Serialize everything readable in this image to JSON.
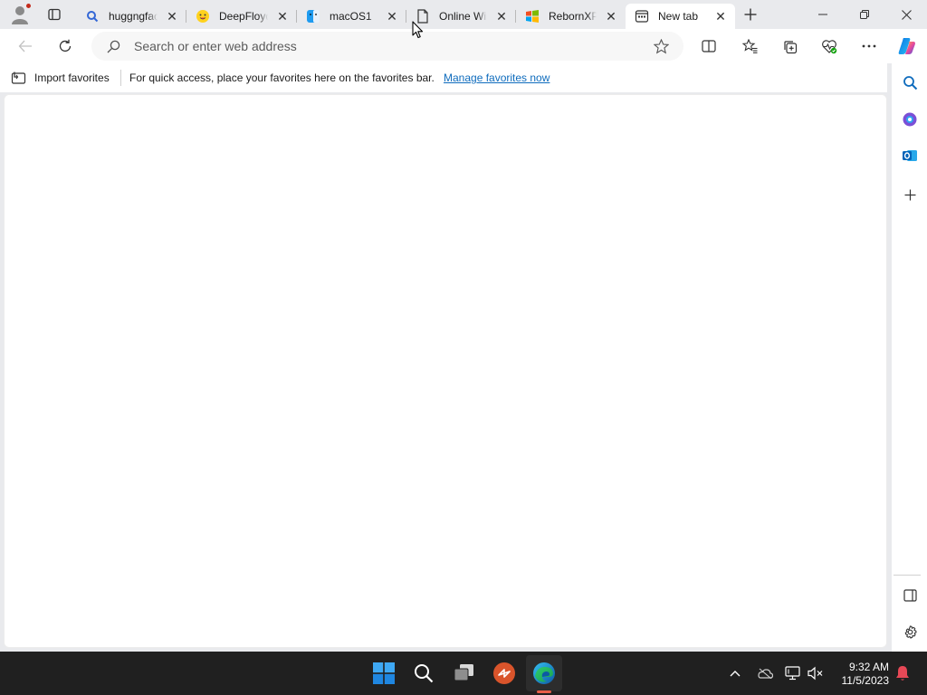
{
  "browser": {
    "tabs": [
      {
        "label": "huggngfac",
        "icon": "search-favicon"
      },
      {
        "label": "DeepFloyd",
        "icon": "hugging-face-favicon"
      },
      {
        "label": "macOS1",
        "icon": "finder-favicon"
      },
      {
        "label": "Online Wir",
        "icon": "page-favicon"
      },
      {
        "label": "RebornXP",
        "icon": "windows-xp-favicon"
      },
      {
        "label": "New tab",
        "icon": "new-tab-favicon",
        "active": true
      }
    ],
    "address_bar": {
      "placeholder": "Search or enter web address",
      "value": ""
    }
  },
  "favorites_bar": {
    "import_label": "Import favorites",
    "message": "For quick access, place your favorites here on the favorites bar.",
    "manage_link": "Manage favorites now"
  },
  "taskbar": {
    "clock_time": "9:32 AM",
    "clock_date": "11/5/2023"
  },
  "colors": {
    "accent_link": "#0f6cbd",
    "tabstrip_bg": "#e9eaed",
    "taskbar_bg": "#202020",
    "notification_bell": "#e74856"
  }
}
